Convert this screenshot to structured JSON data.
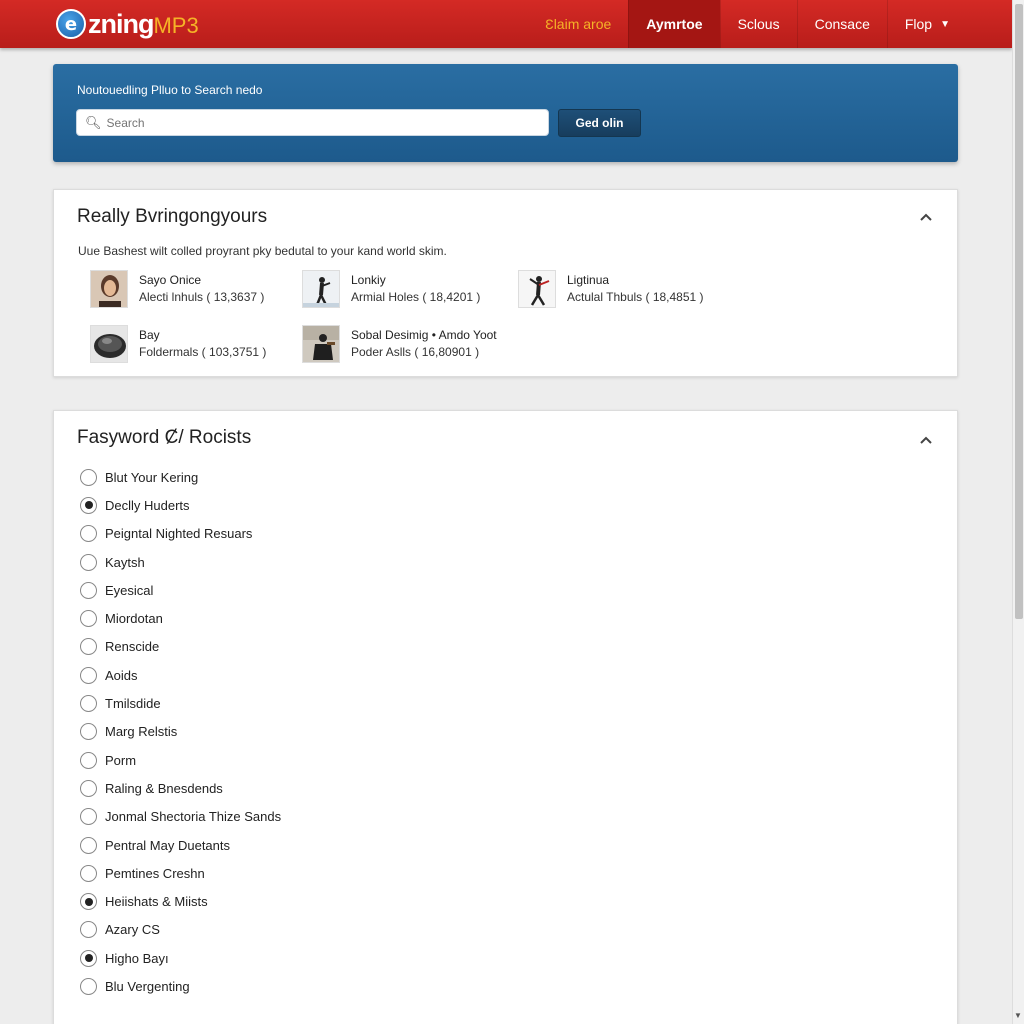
{
  "brand": {
    "logo_letter": "e",
    "name": "zning",
    "suffix": "MP3"
  },
  "nav": [
    {
      "label": "Ɛlaim aroe"
    },
    {
      "label": "Aymrtoe"
    },
    {
      "label": "Sclous"
    },
    {
      "label": "Consace"
    },
    {
      "label": "Flop"
    }
  ],
  "search": {
    "title": "Noutouedling Plluo to Search nedo",
    "placeholder": "Search",
    "button_label": "Ged olin"
  },
  "featured": {
    "title": "Really Bvringongyours",
    "subtitle": "Uue Bashest wilt colled proyrant pky bedutal to your kand world skim.",
    "artists": [
      {
        "name": "Sayo Onice",
        "detail": "Alecti lnhuls  ( 13,3637 )"
      },
      {
        "name": "Lonkiy",
        "detail": "Armial Holes  ( 18,4201 )"
      },
      {
        "name": "Ligtinua",
        "detail": "Actulal Thbuls  ( 18,4851 )"
      },
      {
        "name": "Bay",
        "detail": "Foldermals  ( 103,3751 )"
      },
      {
        "name": "Sobal Desimig • Amdo Yoot",
        "detail": "Poder Aslls  ( 16,80901 )"
      }
    ]
  },
  "filters": {
    "title": "Fasyword Ȼ/ Rocists",
    "items": [
      {
        "label": "Blut Your Kering",
        "checked": false
      },
      {
        "label": "Declly Huderts",
        "checked": true
      },
      {
        "label": "Peigntal Nighted Resuars",
        "checked": false
      },
      {
        "label": "Kaytsh",
        "checked": false
      },
      {
        "label": "Eyesical",
        "checked": false
      },
      {
        "label": "Miordotan",
        "checked": false
      },
      {
        "label": "Renscide",
        "checked": false
      },
      {
        "label": "Aoids",
        "checked": false
      },
      {
        "label": "Tmilsdide",
        "checked": false
      },
      {
        "label": "Marg Relstis",
        "checked": false
      },
      {
        "label": "Porm",
        "checked": false
      },
      {
        "label": "Raling & Bnesdends",
        "checked": false
      },
      {
        "label": "Jonmal Shectoria Thize Sands",
        "checked": false
      },
      {
        "label": "Pentral May Duetants",
        "checked": false
      },
      {
        "label": "Pemtines Creshn",
        "checked": false
      },
      {
        "label": "Heiishats & Miists",
        "checked": true
      },
      {
        "label": "Azary CS",
        "checked": false
      },
      {
        "label": "Higho Bayı",
        "checked": true
      },
      {
        "label": "Blu Vergenting",
        "checked": false
      }
    ]
  },
  "colors": {
    "header_red": "#c8231f",
    "accent_orange": "#f5b227",
    "search_blue": "#235f93"
  }
}
